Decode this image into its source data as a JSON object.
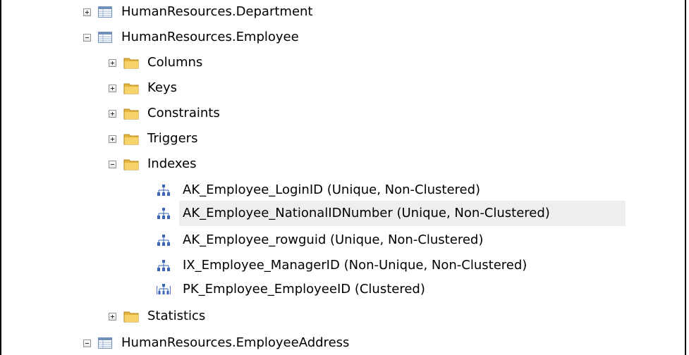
{
  "tree": {
    "nodes": [
      {
        "label": "HumanResources.Department",
        "icon": "table-icon",
        "expanded": false
      },
      {
        "label": "HumanResources.Employee",
        "icon": "table-icon",
        "expanded": true
      },
      {
        "label": "Columns",
        "icon": "folder-icon",
        "expanded": false
      },
      {
        "label": "Keys",
        "icon": "folder-icon",
        "expanded": false
      },
      {
        "label": "Constraints",
        "icon": "folder-icon",
        "expanded": false
      },
      {
        "label": "Triggers",
        "icon": "folder-icon",
        "expanded": false
      },
      {
        "label": "Indexes",
        "icon": "folder-icon",
        "expanded": true
      },
      {
        "label": "AK_Employee_LoginID (Unique, Non-Clustered)",
        "icon": "nonclustered-index-icon"
      },
      {
        "label": "AK_Employee_NationalIDNumber (Unique, Non-Clustered)",
        "icon": "nonclustered-index-icon",
        "selected": true
      },
      {
        "label": "AK_Employee_rowguid (Unique, Non-Clustered)",
        "icon": "nonclustered-index-icon"
      },
      {
        "label": "IX_Employee_ManagerID (Non-Unique, Non-Clustered)",
        "icon": "nonclustered-index-icon"
      },
      {
        "label": "PK_Employee_EmployeeID (Clustered)",
        "icon": "clustered-index-icon"
      },
      {
        "label": "Statistics",
        "icon": "folder-icon",
        "expanded": false
      },
      {
        "label": "HumanResources.EmployeeAddress",
        "icon": "table-icon",
        "expanded": true
      }
    ]
  },
  "colors": {
    "selection": "#eeeeee",
    "folder": "#f2c94c",
    "table": "#6f8fbd",
    "index": "#3a66b5"
  }
}
